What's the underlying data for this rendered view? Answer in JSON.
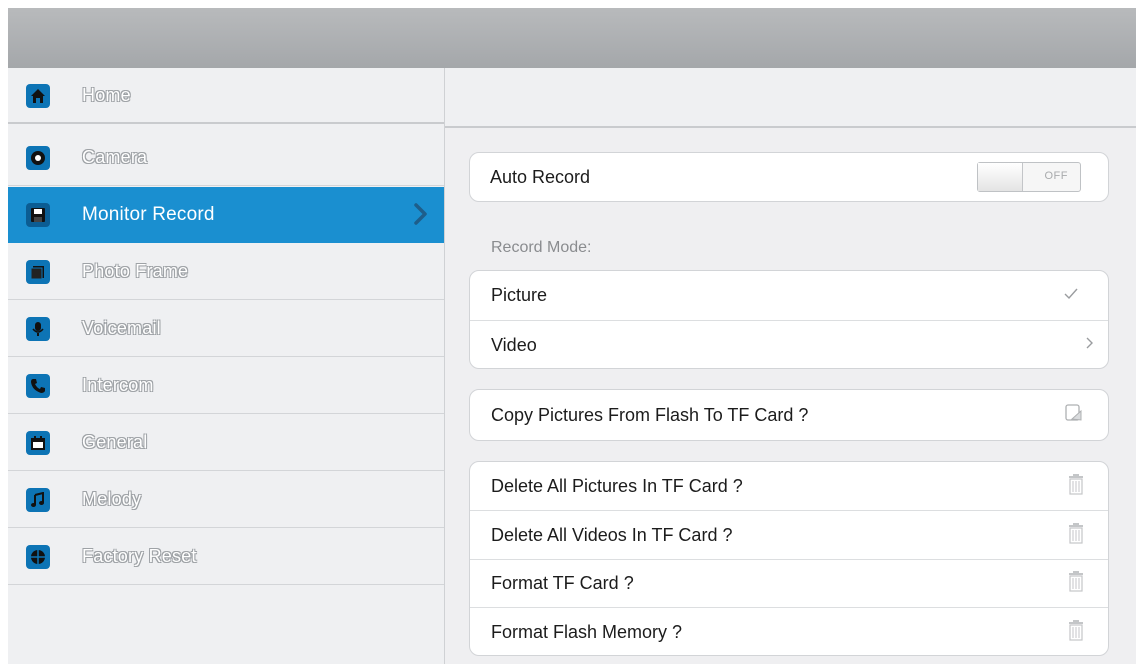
{
  "sidebar": {
    "items": [
      {
        "label": "Home",
        "icon": "home-icon"
      },
      {
        "label": "Camera",
        "icon": "camera-icon"
      },
      {
        "label": "Monitor Record",
        "icon": "floppy-disk-icon"
      },
      {
        "label": "Photo Frame",
        "icon": "photo-frame-icon"
      },
      {
        "label": "Voicemail",
        "icon": "microphone-icon"
      },
      {
        "label": "Intercom",
        "icon": "phone-icon"
      },
      {
        "label": "General",
        "icon": "calendar-icon"
      },
      {
        "label": "Melody",
        "icon": "music-note-icon"
      },
      {
        "label": "Factory Reset",
        "icon": "reset-icon"
      }
    ],
    "active_index": 2
  },
  "settings": {
    "auto_record": {
      "label": "Auto Record",
      "toggle_state": "OFF"
    },
    "record_mode_label": "Record Mode:",
    "record_mode_options": [
      {
        "label": "Picture",
        "selected": true,
        "icon": "checkmark-icon"
      },
      {
        "label": "Video",
        "selected": false,
        "icon": "chevron-right-icon"
      }
    ],
    "copy_action": {
      "label": "Copy Pictures From Flash To TF Card ?",
      "icon": "copy-icon"
    },
    "delete_actions": [
      {
        "label": "Delete All Pictures In TF Card ?",
        "icon": "trash-icon"
      },
      {
        "label": "Delete All Videos In TF Card ?",
        "icon": "trash-icon"
      },
      {
        "label": "Format TF Card ?",
        "icon": "trash-icon"
      },
      {
        "label": "Format Flash Memory ?",
        "icon": "trash-icon"
      }
    ]
  },
  "colors": {
    "accent": "#1a8fd0",
    "icon_blue": "#0d74b5",
    "background": "#efeff1",
    "topbar": "#aeb0b3"
  }
}
